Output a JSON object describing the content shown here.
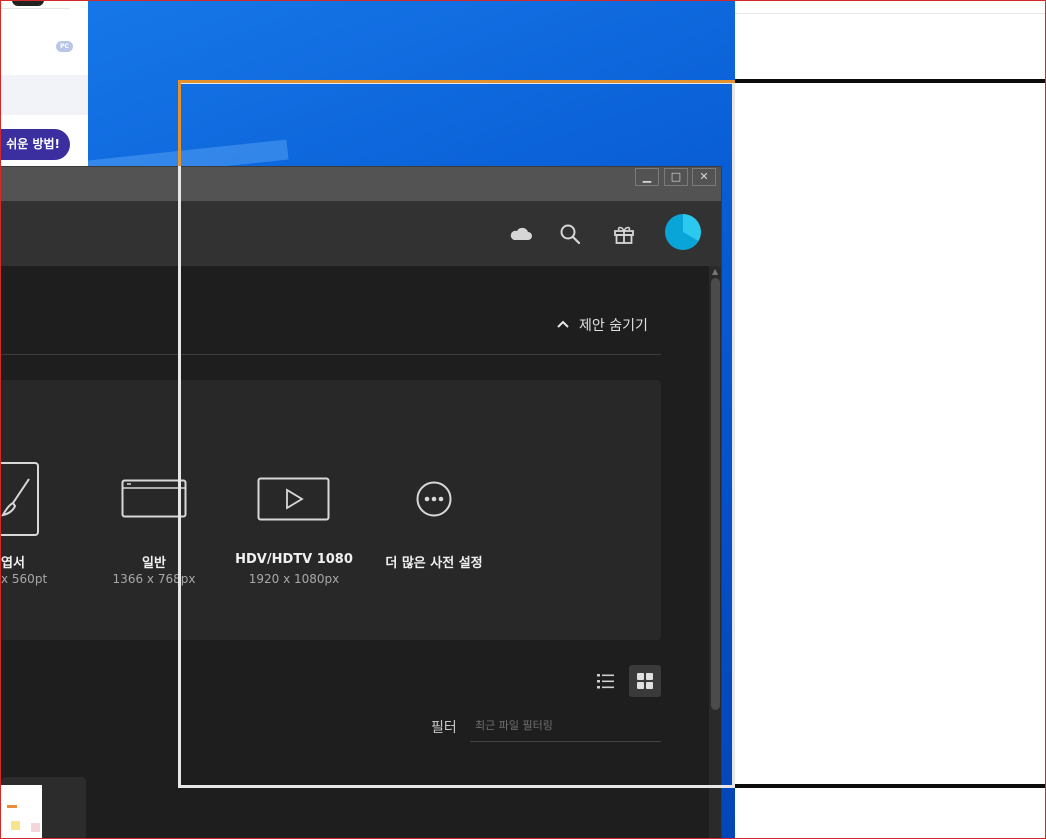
{
  "browser": {
    "badge": "PC",
    "promo_button": "쉬운 방법!"
  },
  "window_controls": {
    "minimize": "▁",
    "maximize": "□",
    "close": "✕"
  },
  "header": {
    "icons": [
      "cloud-icon",
      "search-icon",
      "gift-icon",
      "avatar"
    ]
  },
  "suggestions": {
    "hide_label": "제안 숨기기"
  },
  "presets": [
    {
      "name": "엽서",
      "size": "x 560pt",
      "icon": "brush-icon"
    },
    {
      "name": "일반",
      "size": "1366 x 768px",
      "icon": "browser-window-icon"
    },
    {
      "name": "HDV/HDTV 1080",
      "size": "1920 x 1080px",
      "icon": "video-play-icon"
    },
    {
      "name": "더 많은 사전 설정",
      "size": "",
      "icon": "more-options-icon"
    }
  ],
  "recent": {
    "filter_label": "필터",
    "filter_placeholder": "최근 파일 필터링",
    "view_modes": [
      "list-view",
      "grid-view"
    ],
    "active_view": "grid-view"
  },
  "colors": {
    "window_bg": "#1e1e1e",
    "header_bg": "#323232",
    "titlebar_bg": "#535353",
    "avatar": "#2cc9ef",
    "selection_border": "#e7e7e7",
    "selection_accent": "#e3922e",
    "desktop_blue": "#0a5fd6"
  }
}
